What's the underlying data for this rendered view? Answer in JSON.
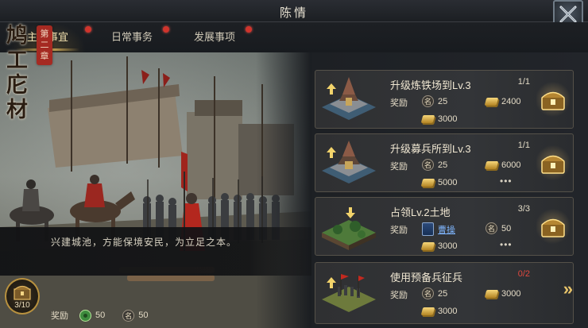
{
  "header": {
    "title": "陈情"
  },
  "tabs": [
    {
      "label": "主要事宜",
      "active": true,
      "has_dot": true
    },
    {
      "label": "日常事务",
      "active": false,
      "has_dot": true
    },
    {
      "label": "发展事项",
      "active": false,
      "has_dot": true
    }
  ],
  "chapter": {
    "title_chars": [
      "鸠",
      "工",
      "庀",
      "材"
    ],
    "seal_chars": [
      "第",
      "二",
      "章"
    ],
    "description": "兴建城池，方能保境安民，为立足之本。",
    "progress": "3/10",
    "reward_label": "奖励",
    "rewards": [
      {
        "icon": "jade-coin-icon",
        "value": "50"
      },
      {
        "icon": "fame-icon",
        "glyph": "名",
        "value": "50"
      }
    ]
  },
  "tasks": [
    {
      "name": "升级炼铁场到Lv.3",
      "count": "1/1",
      "count_color": "normal",
      "thumb": "ironworks-building-icon",
      "upgrade_arrow": true,
      "reward_label": "奖励",
      "rewards": [
        {
          "icon": "fame-icon",
          "glyph": "名",
          "value": "25"
        },
        {
          "icon": "gold-icon",
          "value": "2400"
        },
        {
          "icon": "gold-icon",
          "value": "3000"
        }
      ],
      "more": "",
      "action": "claim-chest"
    },
    {
      "name": "升级募兵所到Lv.3",
      "count": "1/1",
      "count_color": "normal",
      "thumb": "barracks-building-icon",
      "upgrade_arrow": true,
      "reward_label": "奖励",
      "rewards": [
        {
          "icon": "fame-icon",
          "glyph": "名",
          "value": "25"
        },
        {
          "icon": "gold-icon",
          "value": "6000"
        },
        {
          "icon": "gold-icon",
          "value": "5000"
        }
      ],
      "more": "•••",
      "action": "claim-chest"
    },
    {
      "name": "占领Lv.2土地",
      "count": "3/3",
      "count_color": "normal",
      "thumb": "land-tile-icon",
      "upgrade_arrow": false,
      "reward_label": "奖励",
      "rewards": [
        {
          "icon": "hero-card-icon",
          "value": "曹操"
        },
        {
          "icon": "fame-icon",
          "glyph": "名",
          "value": "50"
        },
        {
          "icon": "gold-icon",
          "value": "3000"
        }
      ],
      "more": "•••",
      "action": "claim-chest"
    },
    {
      "name": "使用预备兵征兵",
      "count": "0/2",
      "count_color": "red",
      "thumb": "army-troops-icon",
      "upgrade_arrow": false,
      "reward_label": "奖励",
      "rewards": [
        {
          "icon": "fame-icon",
          "glyph": "名",
          "value": "25"
        },
        {
          "icon": "gold-icon",
          "value": "3000"
        },
        {
          "icon": "gold-icon",
          "value": "3000"
        }
      ],
      "more": "",
      "action": "go-arrow",
      "action_glyph": "»"
    }
  ],
  "colors": {
    "accent_gold": "#d9b25a",
    "red_count": "#e0483f",
    "hero_link": "#7fb6ff"
  }
}
